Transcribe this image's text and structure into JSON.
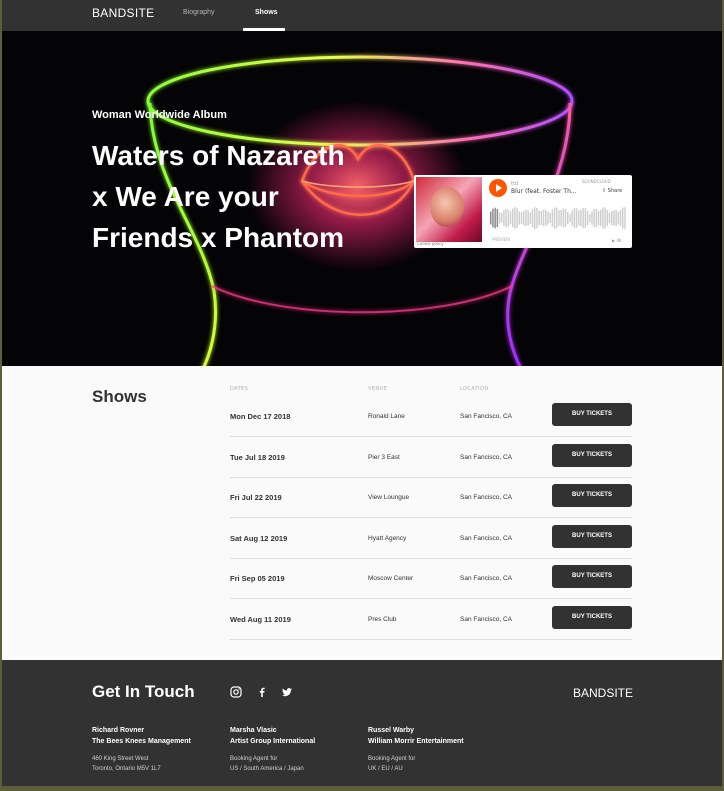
{
  "nav": {
    "brand": "BANDSITE",
    "links": [
      "Biography",
      "Shows"
    ]
  },
  "hero": {
    "kicker": "Woman Worldwide Album",
    "title_lines": [
      "Waters of Nazareth",
      "x We Are your",
      "Friends x Phantom"
    ]
  },
  "soundcloud": {
    "artist": "ttd",
    "track": "Blur (feat. Foster Th...",
    "logo": "SOUNDCLOUD",
    "share": "Share",
    "cookie": "Cookie policy",
    "preview": "PREVIEW",
    "play_count": "4K"
  },
  "shows": {
    "title": "Shows",
    "headers": [
      "DATES",
      "VENUE",
      "LOCATION"
    ],
    "button_label": "BUY TICKETS",
    "rows": [
      {
        "date": "Mon Dec 17 2018",
        "venue": "Ronald Lane",
        "location": "San Fancisco, CA"
      },
      {
        "date": "Tue Jul 18 2019",
        "venue": "Pier 3 East",
        "location": "San Fancisco, CA"
      },
      {
        "date": "Fri Jul 22 2019",
        "venue": "View Loungue",
        "location": "San Fancisco, CA"
      },
      {
        "date": "Sat Aug 12 2019",
        "venue": "Hyatt Agency",
        "location": "San Fancisco, CA"
      },
      {
        "date": "Fri Sep 05 2019",
        "venue": "Moscow Center",
        "location": "San Fancisco, CA"
      },
      {
        "date": "Wed Aug 11 2019",
        "venue": "Pres Club",
        "location": "San Fancisco, CA"
      }
    ]
  },
  "footer": {
    "title": "Get In Touch",
    "brand": "BANDSITE",
    "social_icons": [
      "instagram-icon",
      "facebook-icon",
      "twitter-icon"
    ],
    "contacts": [
      {
        "name": "Richard Rovner",
        "org": "The Bees Knees Management",
        "line1": "460 King Street West",
        "line2": "Toronto, Ontario M5V 1L7"
      },
      {
        "name": "Marsha Vlasic",
        "org": "Artist Group International",
        "line1": "Booking Agent for",
        "line2": "US / South America / Japan"
      },
      {
        "name": "Russel Warby",
        "org": "William Morrir Entertainment",
        "line1": "Booking Agent for",
        "line2": "UK / EU / AU"
      }
    ]
  },
  "colors": {
    "dark": "#323232",
    "accent_orange": "#ff5500",
    "neon_green": "#7dff3a",
    "neon_purple": "#b34dff",
    "neon_pink": "#ff3a8c"
  }
}
